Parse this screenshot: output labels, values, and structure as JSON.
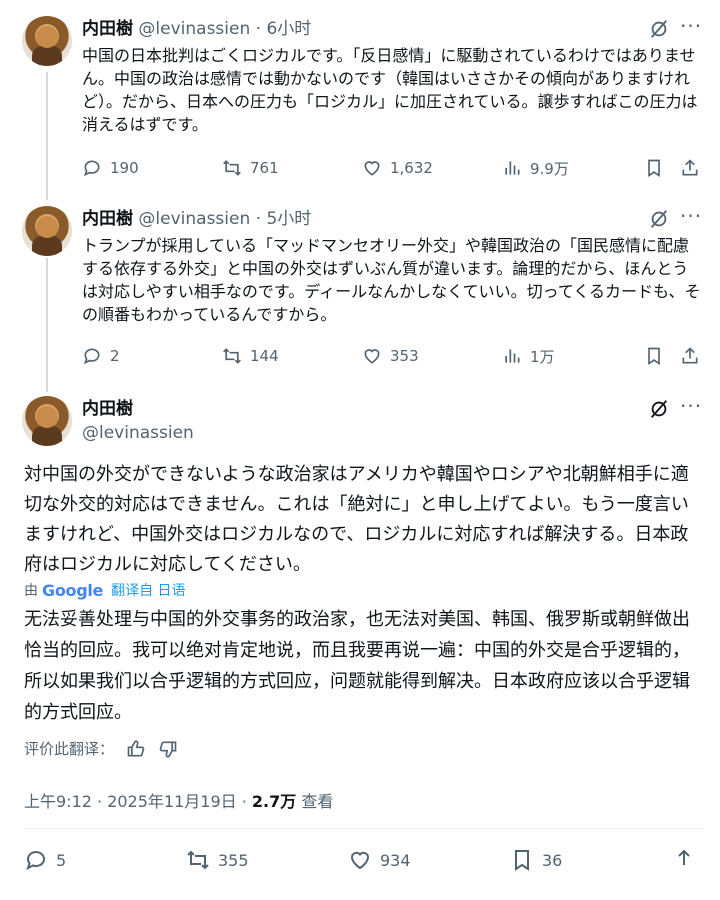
{
  "tweets": [
    {
      "name": "内田樹",
      "handle": "@levinassien",
      "time": "6小时",
      "text": "中国の日本批判はごくロジカルです。「反日感情」に駆動されているわけではありません。中国の政治は感情では動かないのです（韓国はいささかその傾向がありますけれど）。だから、日本への圧力も「ロジカル」に加圧されている。譲歩すればこの圧力は消えるはずです。",
      "replies": "190",
      "reposts": "761",
      "likes": "1,632",
      "views": "9.9万"
    },
    {
      "name": "内田樹",
      "handle": "@levinassien",
      "time": "5小时",
      "text": "トランプが採用している「マッドマンセオリー外交」や韓国政治の「国民感情に配慮する依存する外交」と中国の外交はずいぶん質が違います。論理的だから、ほんとうは対応しやすい相手なのです。ディールなんかしなくていい。切ってくるカードも、その順番もわかっているんですから。",
      "replies": "2",
      "reposts": "144",
      "likes": "353",
      "views": "1万"
    }
  ],
  "main_tweet": {
    "name": "内田樹",
    "handle": "@levinassien",
    "text": "対中国の外交ができないような政治家はアメリカや韓国やロシアや北朝鮮相手に適切な外交的対応はできません。これは「絶対に」と申し上げてよい。もう一度言いますけれど、中国外交はロジカルなので、ロジカルに対応すれば解決する。日本政府はロジカルに対応してください。",
    "translated_by": "由",
    "google": "Google",
    "translated_from": "翻译自 日语",
    "translation": "无法妥善处理与中国的外交事务的政治家，也无法对美国、韩国、俄罗斯或朝鲜做出恰当的回应。我可以绝对肯定地说，而且我要再说一遍：中国的外交是合乎逻辑的，所以如果我们以合乎逻辑的方式回应，问题就能得到解决。日本政府应该以合乎逻辑的方式回应。",
    "rate_label": "评价此翻译：",
    "timestamp": "上午9:12 · 2025年11月19日 · ",
    "views_count": "2.7万",
    "views_label": " 查看",
    "replies": "5",
    "reposts": "355",
    "likes": "934",
    "bookmarks": "36"
  },
  "colors": {
    "text": "#0f1419",
    "secondary": "#536471",
    "link": "#1d9bf0",
    "thread_line": "#cfd9de"
  }
}
